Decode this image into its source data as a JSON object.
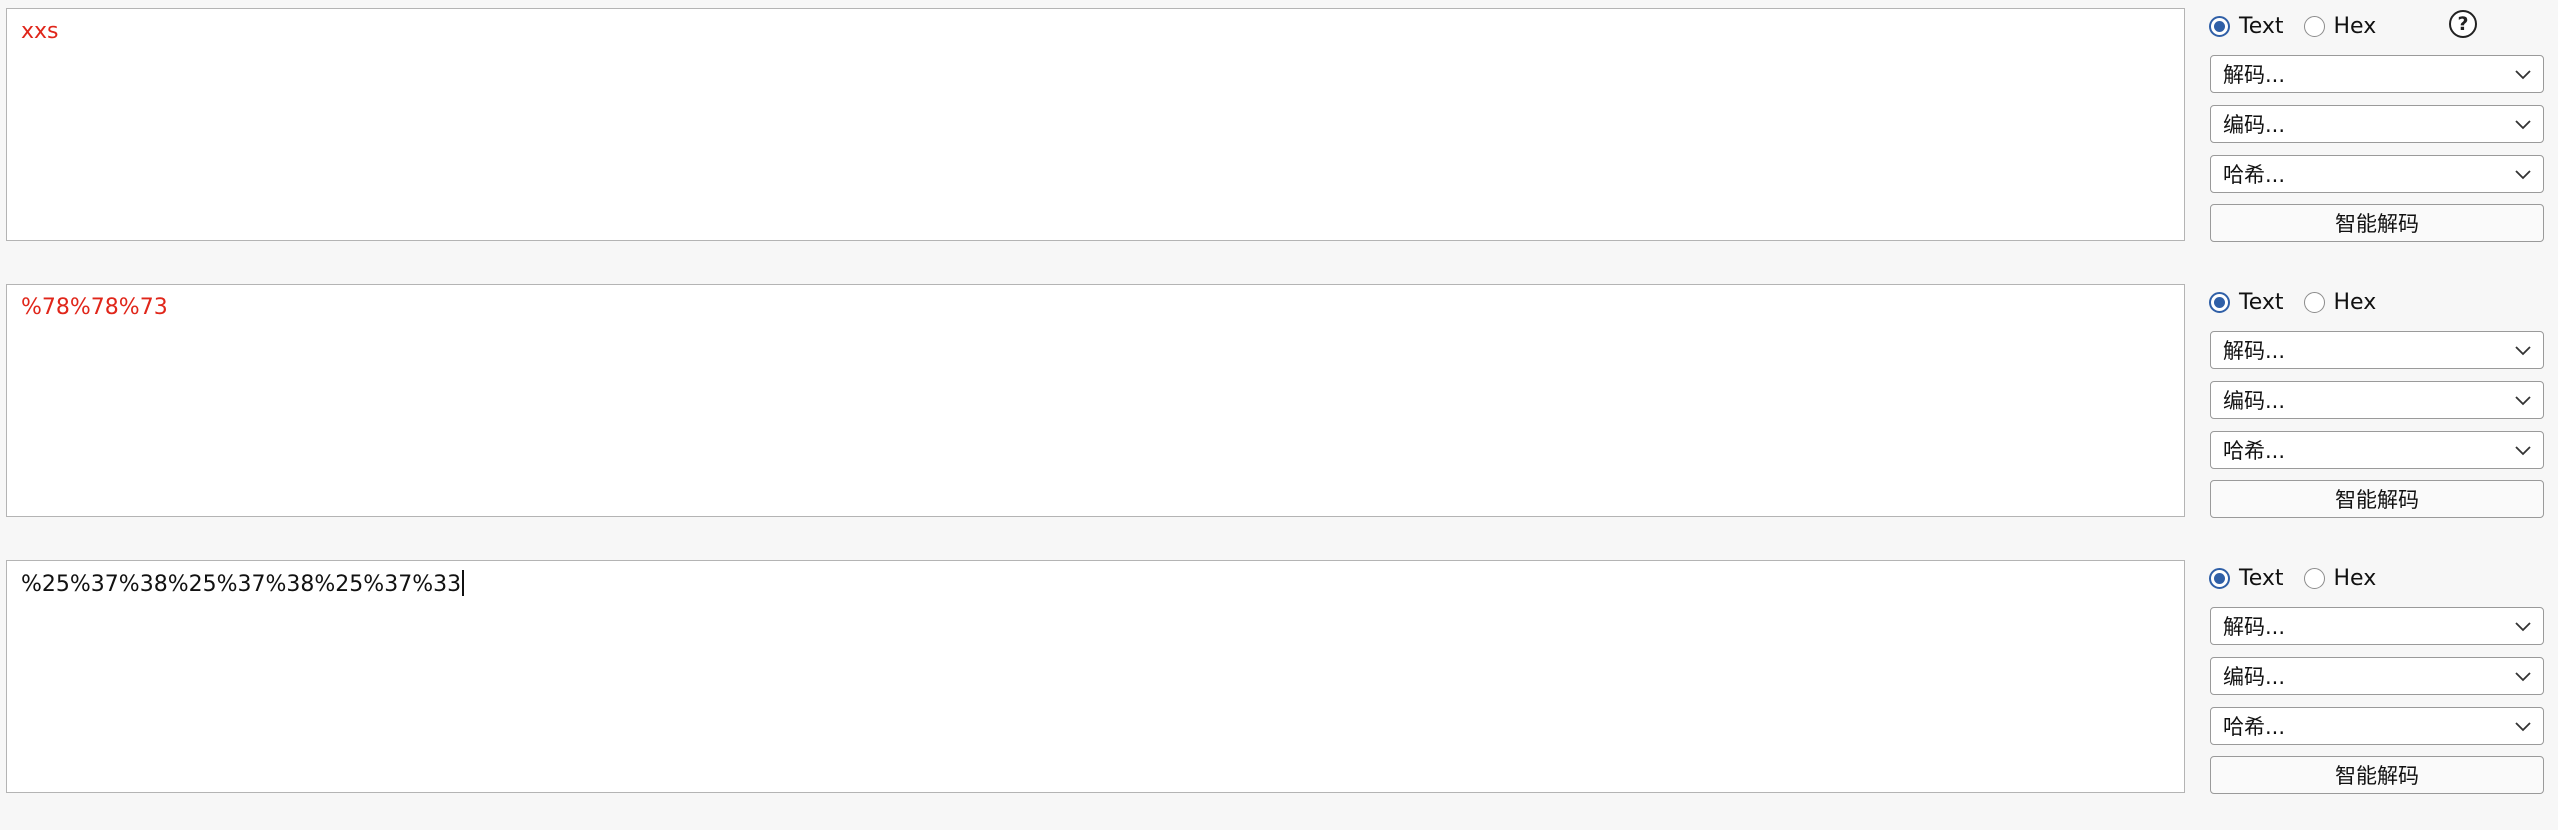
{
  "panels": [
    {
      "text": "xxs",
      "text_color": "#e0261a",
      "mode": {
        "text_label": "Text",
        "hex_label": "Hex",
        "selected": "Text"
      },
      "decode_label": "解码...",
      "encode_label": "编码...",
      "hash_label": "哈希...",
      "smart_decode_label": "智能解码",
      "help_label": "?"
    },
    {
      "text": "%78%78%73",
      "text_color": "#e0261a",
      "mode": {
        "text_label": "Text",
        "hex_label": "Hex",
        "selected": "Text"
      },
      "decode_label": "解码...",
      "encode_label": "编码...",
      "hash_label": "哈希...",
      "smart_decode_label": "智能解码"
    },
    {
      "text": "%25%37%38%25%37%38%25%37%33",
      "text_color": "#111111",
      "mode": {
        "text_label": "Text",
        "hex_label": "Hex",
        "selected": "Text"
      },
      "decode_label": "解码...",
      "encode_label": "编码...",
      "hash_label": "哈希...",
      "smart_decode_label": "智能解码"
    }
  ]
}
